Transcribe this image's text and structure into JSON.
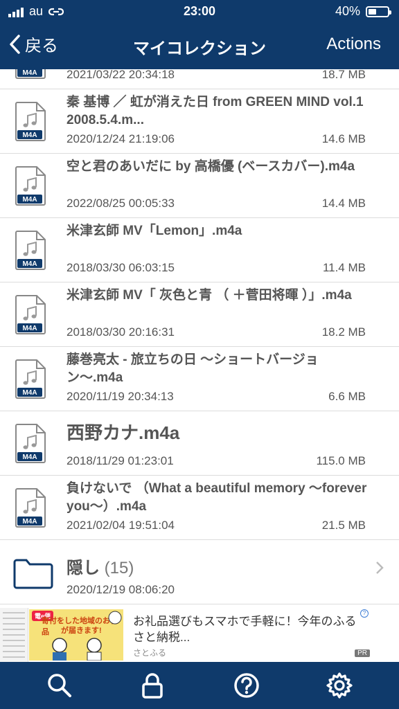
{
  "status_bar": {
    "carrier": "au",
    "time": "23:00",
    "battery": "40%"
  },
  "nav": {
    "back_label": "戻る",
    "title": "マイコレクション",
    "actions_label": "Actions"
  },
  "colors": {
    "nav_bg": "#0f3a6b",
    "icon_badge": "#0f3a6b"
  },
  "file_badge": "M4A",
  "files": [
    {
      "name": "",
      "date": "2021/03/22 20:34:18",
      "size": "18.7 MB"
    },
    {
      "name": "秦 基博 ／ 虹が消えた日 from GREEN MIND vol.1 2008.5.4.m...",
      "date": "2020/12/24 21:19:06",
      "size": "14.6 MB"
    },
    {
      "name": "空と君のあいだに by 高橋優 (ベースカバー).m4a",
      "date": "2022/08/25 00:05:33",
      "size": "14.4 MB"
    },
    {
      "name": "米津玄師  MV「Lemon」.m4a",
      "date": "2018/03/30 06:03:15",
      "size": "11.4 MB"
    },
    {
      "name": "米津玄師  MV「 灰色と青 （ ＋菅田将暉 ）」.m4a",
      "date": "2018/03/30 20:16:31",
      "size": "18.2 MB"
    },
    {
      "name": "藤巻亮太 - 旅立ちの日 〜ショートバージョン〜.m4a",
      "date": "2020/11/19 20:34:13",
      "size": "6.6 MB"
    },
    {
      "name": "西野カナ.m4a",
      "date": "2018/11/29 01:23:01",
      "size": "115.0 MB"
    },
    {
      "name": "負けないで （What a beautiful memory 〜forever you〜）.m4a",
      "date": "2021/02/04 19:51:04",
      "size": "21.5 MB"
    }
  ],
  "folder": {
    "name": "隠し",
    "count": "(15)",
    "date": "2020/12/19 08:06:20"
  },
  "ad": {
    "banner_tag": "電e便",
    "banner_text_1": "寄付をした地域のお礼品",
    "banner_text_2": "が届きます!",
    "text": "お礼品選びもスマホで手軽に！今年のふるさと納税...",
    "sponsor": "さとふる",
    "pr": "PR"
  },
  "tabbar": [
    "search-icon",
    "lock-icon",
    "help-icon",
    "settings-icon"
  ]
}
